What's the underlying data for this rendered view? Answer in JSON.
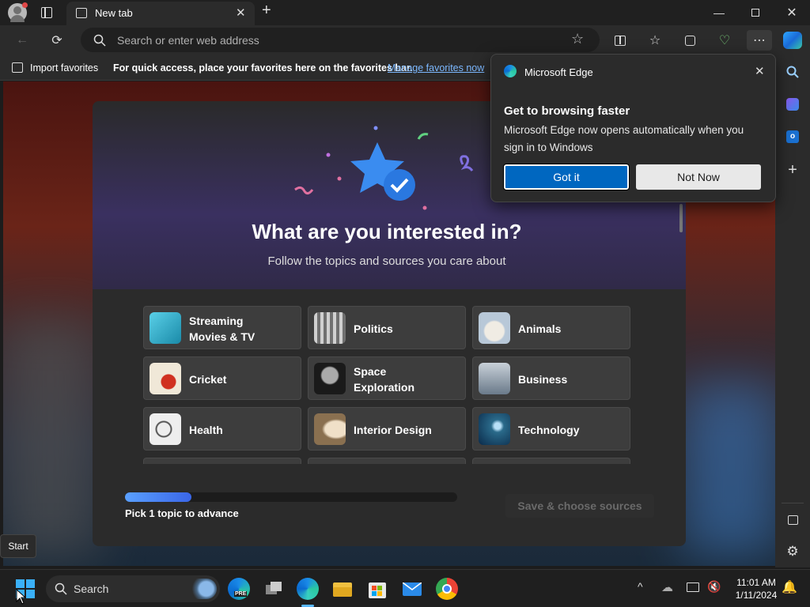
{
  "browser": {
    "tab_title": "New tab",
    "address_placeholder": "Search or enter web address"
  },
  "favorites_bar": {
    "import_label": "Import favorites",
    "message": "For quick access, place your favorites here on the favorites bar.",
    "manage_link": "Manage favorites now"
  },
  "onboarding": {
    "heading": "What are you interested in?",
    "subheading": "Follow the topics and sources you care about",
    "topics": [
      {
        "label": "Streaming Movies & TV",
        "color": "#2aa8c8"
      },
      {
        "label": "Politics",
        "color": "#8a8a8a"
      },
      {
        "label": "Animals",
        "color": "#c8c0b8"
      },
      {
        "label": "Cricket",
        "color": "#e8e0d0"
      },
      {
        "label": "Space Exploration",
        "color": "#404040"
      },
      {
        "label": "Business",
        "color": "#9aa0a8"
      },
      {
        "label": "Health",
        "color": "#e8e8e8"
      },
      {
        "label": "Interior Design",
        "color": "#b89878"
      },
      {
        "label": "Technology",
        "color": "#4a7a9a"
      }
    ],
    "progress_fraction": 0.2,
    "hint": "Pick 1 topic to advance",
    "save_label": "Save & choose sources"
  },
  "popup": {
    "app_name": "Microsoft Edge",
    "title": "Get to browsing faster",
    "message": "Microsoft Edge now opens automatically when you sign in to Windows",
    "got_it": "Got it",
    "not_now": "Not Now"
  },
  "taskbar": {
    "search_label": "Search",
    "time": "11:01 AM",
    "date": "1/11/2024",
    "tooltip": "Start",
    "pre_badge": "PRE"
  },
  "colors": {
    "accent": "#0067c0",
    "link": "#7cb8ff"
  }
}
